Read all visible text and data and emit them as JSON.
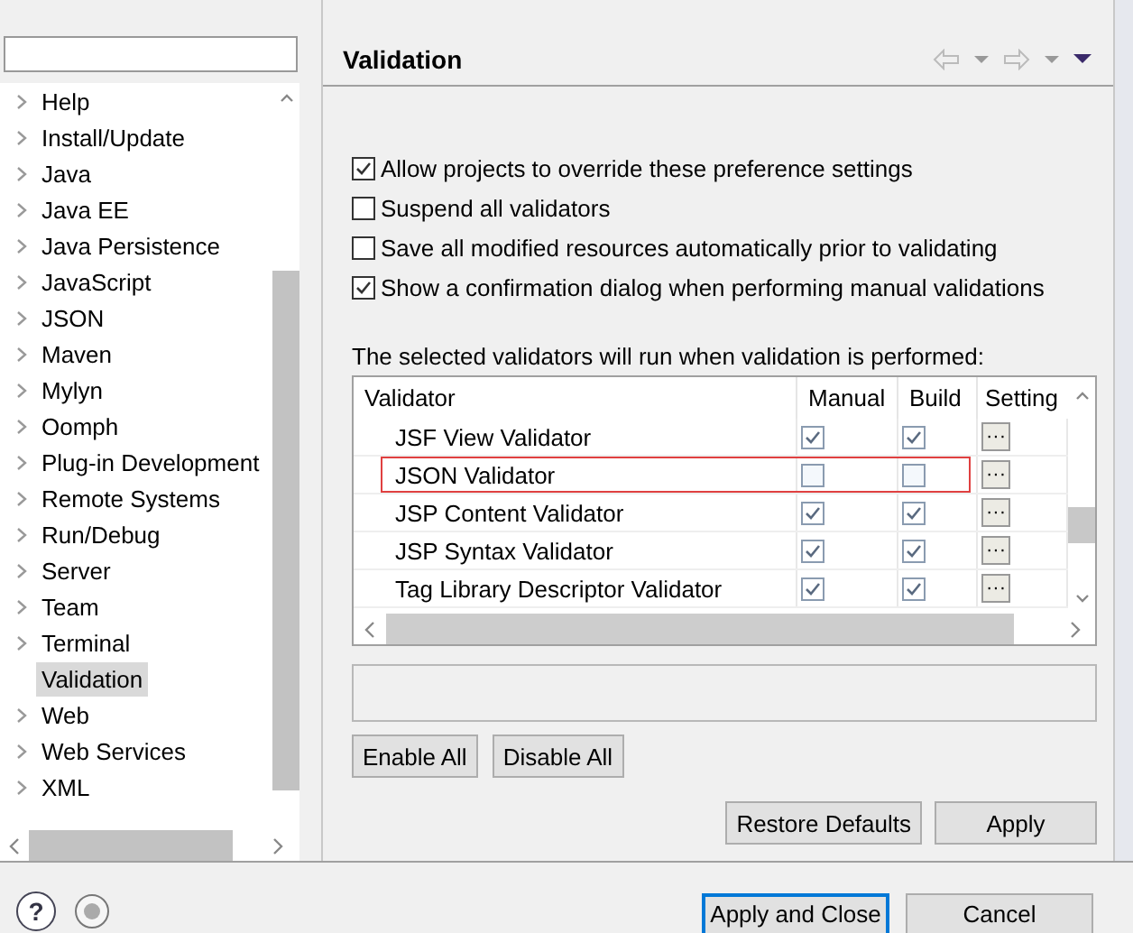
{
  "tree": {
    "items": [
      {
        "label": "Help",
        "expandable": true,
        "selected": false
      },
      {
        "label": "Install/Update",
        "expandable": true,
        "selected": false
      },
      {
        "label": "Java",
        "expandable": true,
        "selected": false
      },
      {
        "label": "Java EE",
        "expandable": true,
        "selected": false
      },
      {
        "label": "Java Persistence",
        "expandable": true,
        "selected": false
      },
      {
        "label": "JavaScript",
        "expandable": true,
        "selected": false
      },
      {
        "label": "JSON",
        "expandable": true,
        "selected": false
      },
      {
        "label": "Maven",
        "expandable": true,
        "selected": false
      },
      {
        "label": "Mylyn",
        "expandable": true,
        "selected": false
      },
      {
        "label": "Oomph",
        "expandable": true,
        "selected": false
      },
      {
        "label": "Plug-in Development",
        "expandable": true,
        "selected": false
      },
      {
        "label": "Remote Systems",
        "expandable": true,
        "selected": false
      },
      {
        "label": "Run/Debug",
        "expandable": true,
        "selected": false
      },
      {
        "label": "Server",
        "expandable": true,
        "selected": false
      },
      {
        "label": "Team",
        "expandable": true,
        "selected": false
      },
      {
        "label": "Terminal",
        "expandable": true,
        "selected": false
      },
      {
        "label": "Validation",
        "expandable": false,
        "selected": true
      },
      {
        "label": "Web",
        "expandable": true,
        "selected": false
      },
      {
        "label": "Web Services",
        "expandable": true,
        "selected": false
      },
      {
        "label": "XML",
        "expandable": true,
        "selected": false
      }
    ]
  },
  "page": {
    "title": "Validation",
    "options": [
      {
        "label": "Allow projects to override these preference settings",
        "checked": true
      },
      {
        "label": "Suspend all validators",
        "checked": false
      },
      {
        "label": "Save all modified resources automatically prior to validating",
        "checked": false
      },
      {
        "label": "Show a confirmation dialog when performing manual validations",
        "checked": true
      }
    ],
    "table_label": "The selected validators will run when validation is performed:",
    "table": {
      "columns": [
        "Validator",
        "Manual",
        "Build",
        "Setting"
      ],
      "rows": [
        {
          "name": "JSF View Validator",
          "manual": true,
          "build": true,
          "settings": "···",
          "highlighted": false
        },
        {
          "name": "JSON Validator",
          "manual": false,
          "build": false,
          "settings": "···",
          "highlighted": true
        },
        {
          "name": "JSP Content Validator",
          "manual": true,
          "build": true,
          "settings": "···",
          "highlighted": false
        },
        {
          "name": "JSP Syntax Validator",
          "manual": true,
          "build": true,
          "settings": "···",
          "highlighted": false
        },
        {
          "name": "Tag Library Descriptor Validator",
          "manual": true,
          "build": true,
          "settings": "···",
          "highlighted": false
        }
      ]
    },
    "table_buttons": [
      "Enable All",
      "Disable All"
    ],
    "page_buttons": [
      "Restore Defaults",
      "Apply"
    ]
  },
  "help": "?",
  "dialog_buttons": [
    {
      "label": "Apply and Close",
      "default": true
    },
    {
      "label": "Cancel",
      "default": false
    }
  ]
}
